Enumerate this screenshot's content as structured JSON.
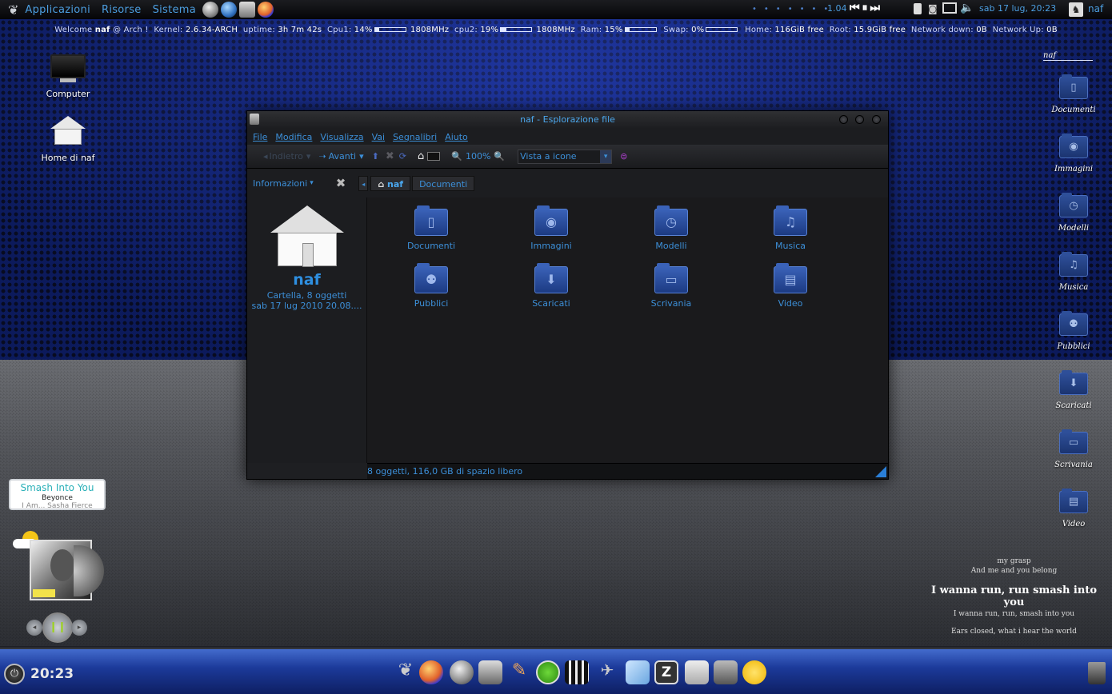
{
  "top_panel": {
    "menus": [
      "Applicazioni",
      "Risorse",
      "Sistema"
    ],
    "volume_value": "1.04",
    "clock": "sab 17 lug, 20:23",
    "user": "naf"
  },
  "conky": {
    "welcome": "Welcome",
    "user": "naf",
    "at_host": "@ Arch !",
    "kernel_label": "Kernel:",
    "kernel": "2.6.34-ARCH",
    "uptime_label": "uptime:",
    "uptime": "3h 7m 42s",
    "cpu1_label": "Cpu1:",
    "cpu1_pct": "14%",
    "cpu1_mhz": "1808MHz",
    "cpu2_label": "cpu2:",
    "cpu2_pct": "19%",
    "cpu2_mhz": "1808MHz",
    "ram_label": "Ram:",
    "ram_pct": "15%",
    "swap_label": "Swap:",
    "swap_pct": "0%",
    "home_label": "Home:",
    "home": "116GiB free",
    "root_label": "Root:",
    "root": "15.9GiB free",
    "net_down_label": "Network down:",
    "net_down": "0B",
    "net_up_label": "Network Up:",
    "net_up": "0B",
    "cpu1_fraction": 0.14,
    "cpu2_fraction": 0.19,
    "ram_fraction": 0.15,
    "swap_fraction": 0.0
  },
  "desktop": {
    "computer_label": "Computer",
    "home_label": "Home di naf",
    "right_header": "naf",
    "right_folders": [
      {
        "label": "Documenti",
        "icon": "document-icon"
      },
      {
        "label": "Immagini",
        "icon": "camera-icon"
      },
      {
        "label": "Modelli",
        "icon": "template-icon"
      },
      {
        "label": "Musica",
        "icon": "music-icon"
      },
      {
        "label": "Pubblici",
        "icon": "people-icon"
      },
      {
        "label": "Scaricati",
        "icon": "download-icon"
      },
      {
        "label": "Scrivania",
        "icon": "desktop-icon"
      },
      {
        "label": "Video",
        "icon": "film-icon"
      }
    ]
  },
  "window": {
    "title": "naf - Esplorazione file",
    "menu": [
      "File",
      "Modifica",
      "Visualizza",
      "Vai",
      "Segnalibri",
      "Aiuto"
    ],
    "toolbar": {
      "back": "Indietro",
      "forward": "Avanti",
      "zoom": "100%",
      "view": "Vista a icone"
    },
    "sidebar": {
      "selector": "Informazioni",
      "name": "naf",
      "info": "Cartella, 8 oggetti",
      "date": "sab 17 lug 2010 20.08...."
    },
    "breadcrumbs": [
      "naf",
      "Documenti"
    ],
    "files": [
      {
        "label": "Documenti",
        "icon": "document-icon"
      },
      {
        "label": "Immagini",
        "icon": "camera-icon"
      },
      {
        "label": "Modelli",
        "icon": "template-icon"
      },
      {
        "label": "Musica",
        "icon": "music-icon"
      },
      {
        "label": "Pubblici",
        "icon": "people-icon"
      },
      {
        "label": "Scaricati",
        "icon": "download-icon"
      },
      {
        "label": "Scrivania",
        "icon": "desktop-icon"
      },
      {
        "label": "Video",
        "icon": "film-icon"
      }
    ],
    "status": "8 oggetti, 116,0 GB di spazio libero"
  },
  "music": {
    "title": "Smash Into You",
    "artist": "Beyonce",
    "album": "I Am... Sasha Fierce"
  },
  "lyrics": {
    "line1": "my grasp",
    "line2": "And me and you belong",
    "current": "I wanna run, run smash into you",
    "line4": "I wanna run, run, smash into you",
    "line5": "Ears closed, what i hear the world"
  },
  "dock": {
    "clock": "20:23"
  },
  "colors": {
    "accent": "#3c8fd8",
    "folder": "#2e58b0"
  }
}
